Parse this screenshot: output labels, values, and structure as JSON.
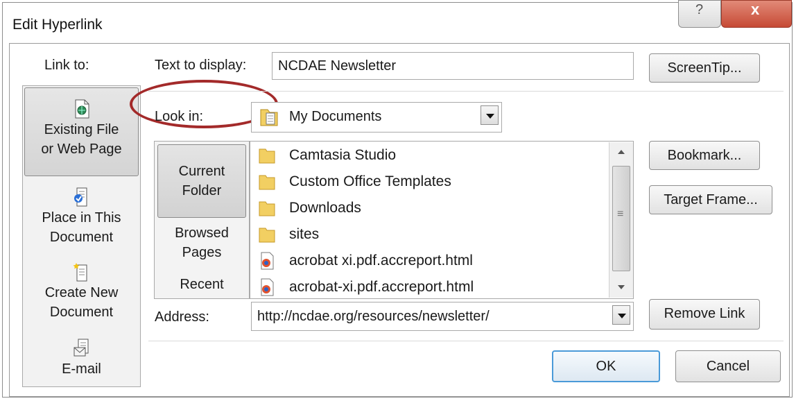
{
  "window": {
    "title": "Edit Hyperlink",
    "help_glyph": "?",
    "close_glyph": "x"
  },
  "link_to": {
    "label": "Link to:",
    "items": [
      {
        "line1": "Existing File",
        "line2": "or Web Page",
        "icon": "globe-doc-icon",
        "selected": true
      },
      {
        "line1": "Place in This",
        "line2": "Document",
        "icon": "place-doc-icon",
        "selected": false
      },
      {
        "line1": "Create New",
        "line2": "Document",
        "icon": "new-doc-icon",
        "selected": false
      },
      {
        "line1": "E-mail",
        "line2": "",
        "icon": "email-icon",
        "selected": false
      }
    ]
  },
  "text_to_display": {
    "label": "Text to display:",
    "value": "NCDAE Newsletter"
  },
  "look_in": {
    "label": "Look in:",
    "value": "My Documents"
  },
  "nav": {
    "items": [
      {
        "line1": "Current",
        "line2": "Folder",
        "selected": true
      },
      {
        "line1": "Browsed",
        "line2": "Pages",
        "selected": false
      },
      {
        "line1": "Recent",
        "line2": "",
        "selected": false
      }
    ]
  },
  "files": [
    {
      "name": "Camtasia Studio",
      "type": "folder"
    },
    {
      "name": "Custom Office Templates",
      "type": "folder"
    },
    {
      "name": "Downloads",
      "type": "folder"
    },
    {
      "name": "sites",
      "type": "folder"
    },
    {
      "name": "acrobat xi.pdf.accreport.html",
      "type": "html"
    },
    {
      "name": "acrobat-xi.pdf.accreport.html",
      "type": "html"
    }
  ],
  "address": {
    "label": "Address:",
    "value": "http://ncdae.org/resources/newsletter/"
  },
  "buttons": {
    "screentip": "ScreenTip...",
    "bookmark": "Bookmark...",
    "target_frame": "Target Frame...",
    "remove_link": "Remove Link",
    "ok": "OK",
    "cancel": "Cancel"
  },
  "colors": {
    "annotation_oval": "#a32a2a",
    "ok_border": "#4a9ad8",
    "close_button": "#c64a35"
  }
}
